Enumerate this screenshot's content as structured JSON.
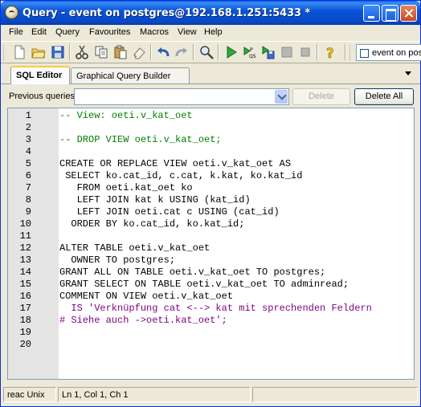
{
  "window": {
    "title": "Query - event on postgres@192.168.1.251:5433 *"
  },
  "menu": [
    "File",
    "Edit",
    "Query",
    "Favourites",
    "Macros",
    "View",
    "Help"
  ],
  "toolbar": {
    "connection_label": "event on postgres",
    "icons": [
      "new-file-icon",
      "open-folder-icon",
      "save-icon",
      "cut-icon",
      "copy-icon",
      "paste-icon",
      "clear-icon",
      "undo-icon",
      "redo-icon",
      "find-icon",
      "execute-icon",
      "explain-icon",
      "execute-to-file-icon",
      "pause-icon",
      "stop-icon",
      "help-icon"
    ]
  },
  "tabs": [
    {
      "label": "SQL Editor",
      "active": true
    },
    {
      "label": "Graphical Query Builder",
      "active": false
    }
  ],
  "previous_queries": {
    "label": "Previous queries",
    "selected": "",
    "delete_label": "Delete",
    "delete_all_label": "Delete All"
  },
  "editor": {
    "lines": [
      "-- View: oeti.v_kat_oet",
      "",
      "-- DROP VIEW oeti.v_kat_oet;",
      "",
      "CREATE OR REPLACE VIEW oeti.v_kat_oet AS",
      " SELECT ko.cat_id, c.cat, k.kat, ko.kat_id",
      "   FROM oeti.kat_oet ko",
      "   LEFT JOIN kat k USING (kat_id)",
      "   LEFT JOIN oeti.cat c USING (cat_id)",
      "  ORDER BY ko.cat_id, ko.kat_id;",
      "",
      "ALTER TABLE oeti.v_kat_oet",
      "  OWNER TO postgres;",
      "GRANT ALL ON TABLE oeti.v_kat_oet TO postgres;",
      "GRANT SELECT ON TABLE oeti.v_kat_oet TO adminread;",
      "COMMENT ON VIEW oeti.v_kat_oet",
      "  IS 'Verknüpfung cat <--> kat mit sprechenden Feldern",
      "# Siehe auch ->oeti.kat_oet';",
      "",
      ""
    ],
    "line_numbers": [
      "1",
      "2",
      "3",
      "4",
      "5",
      "6",
      "7",
      "8",
      "9",
      "10",
      "11",
      "12",
      "13",
      "14",
      "15",
      "16",
      "17",
      "18",
      "19",
      "20"
    ]
  },
  "status": {
    "mode": "reac Unix",
    "position": "Ln 1, Col 1, Ch 1"
  }
}
